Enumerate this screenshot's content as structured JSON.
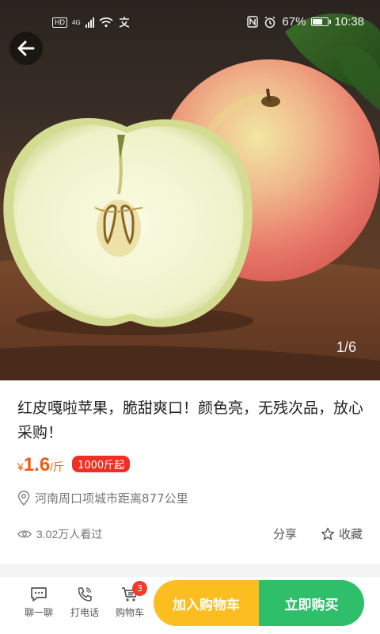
{
  "status_bar": {
    "left_badge": "HD",
    "network": "4G",
    "battery": "67%",
    "battery_level": 0.67,
    "time": "10:38",
    "icons": [
      "hd-icon",
      "signal-icon",
      "wifi-icon",
      "chinese-input-icon",
      "nfc-icon",
      "alarm-icon",
      "battery-icon"
    ]
  },
  "gallery": {
    "counter": "1/6",
    "image_subject": "apple-photo"
  },
  "product": {
    "title": "红皮嘎啦苹果，脆甜爽口！颜色亮，无残次品，放心采购！",
    "price_currency": "¥",
    "price_value": "1.6",
    "price_unit": "/斤",
    "min_order": "1000斤起",
    "location": "河南周口项城市距离877公里",
    "views": "3.02万人看过",
    "share_label": "分享",
    "favorite_label": "收藏"
  },
  "bottom_bar": {
    "chat_label": "聊一聊",
    "call_label": "打电话",
    "cart_label": "购物车",
    "cart_count": "3",
    "add_to_cart": "加入购物车",
    "buy_now": "立即购买"
  },
  "colors": {
    "price": "#f25a0c",
    "badge": "#ee2f24",
    "add_to_cart": "#fbbd20",
    "buy_now": "#2fbe6a"
  }
}
